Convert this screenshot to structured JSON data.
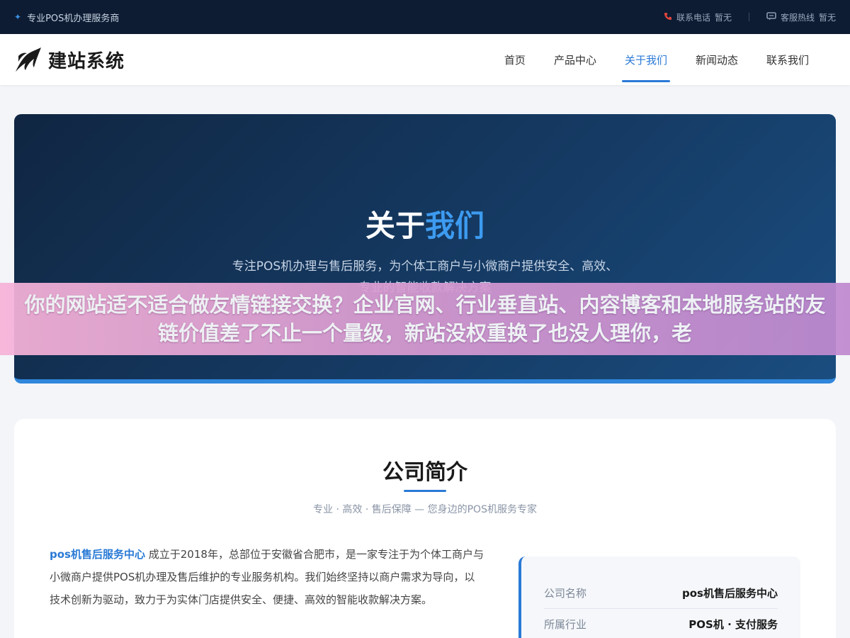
{
  "topbar": {
    "tagline": "专业POS机办理服务商",
    "phone_label": "联系电话",
    "phone_value": "暂无",
    "hotline_label": "客服热线",
    "hotline_value": "暂无"
  },
  "header": {
    "logo_text": "建站系统",
    "nav": [
      {
        "label": "首页"
      },
      {
        "label": "产品中心"
      },
      {
        "label": "关于我们"
      },
      {
        "label": "新闻动态"
      },
      {
        "label": "联系我们"
      }
    ],
    "active_nav": "关于我们"
  },
  "hero": {
    "title_main": "关于",
    "title_accent": "我们",
    "subtitle_line1": "专注POS机办理与售后服务，为个体工商户与小微商户提供安全、高效、",
    "subtitle_line2": "专业的智能收款解决方案"
  },
  "overlay": {
    "text": "你的网站适不适合做友情链接交换？企业官网、行业垂直站、内容博客和本地服务站的友链价值差了不止一个量级，新站没权重换了也没人理你，老"
  },
  "about": {
    "title": "公司简介",
    "subtitle": "专业 · 高效 · 售后保障 — 您身边的POS机服务专家",
    "company_name": "pos机售后服务中心",
    "body": "成立于2018年，总部位于安徽省合肥市，是一家专注于为个体工商户与小微商户提供POS机办理及售后维护的专业服务机构。我们始终坚持以商户需求为导向，以技术创新为驱动，致力于为实体门店提供安全、便捷、高效的智能收款解决方案。",
    "info": [
      {
        "key": "公司名称",
        "value": "pos机售后服务中心"
      },
      {
        "key": "所属行业",
        "value": "POS机 · 支付服务"
      }
    ]
  },
  "colors": {
    "accent": "#2a7ad6",
    "topbar_bg": "#0d1c33",
    "hero_bg": "#153a63"
  }
}
